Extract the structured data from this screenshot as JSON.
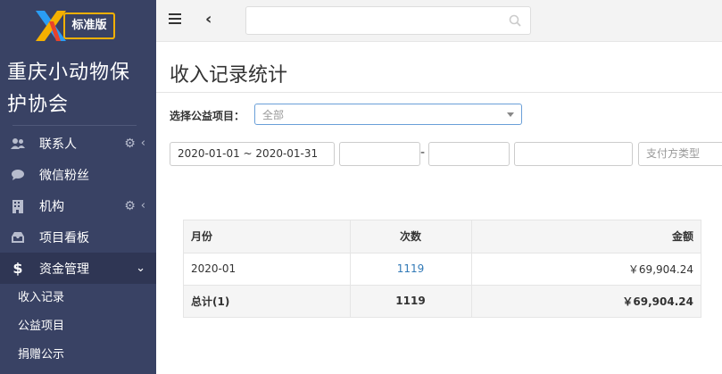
{
  "brand": {
    "badge": "标准版",
    "org_name": "重庆小动物保护协会"
  },
  "sidebar": {
    "items": [
      {
        "label": "联系人",
        "icon": "users-icon",
        "has_gear": true,
        "has_caret": true
      },
      {
        "label": "微信粉丝",
        "icon": "chat-icon",
        "has_gear": false,
        "has_caret": false
      },
      {
        "label": "机构",
        "icon": "building-icon",
        "has_gear": true,
        "has_caret": true
      },
      {
        "label": "项目看板",
        "icon": "inbox-icon",
        "has_gear": false,
        "has_caret": false
      },
      {
        "label": "资金管理",
        "icon": "dollar-icon",
        "has_gear": false,
        "has_caret": true,
        "active": true
      }
    ],
    "subitems": [
      {
        "label": "收入记录"
      },
      {
        "label": "公益项目"
      },
      {
        "label": "捐赠公示"
      }
    ]
  },
  "topbar": {
    "search_placeholder": ""
  },
  "main": {
    "title": "收入记录统计",
    "filter_label": "选择公益项目：",
    "project_select": "全部",
    "date_range": "2020-01-01 ~ 2020-01-31",
    "amount_min": "",
    "dash": "-",
    "amount_max": "",
    "field4": "",
    "payer_type_placeholder": "支付方类型"
  },
  "table": {
    "headers": [
      "月份",
      "次数",
      "金额"
    ],
    "rows": [
      {
        "month": "2020-01",
        "count": "1119",
        "amount": "￥69,904.24"
      }
    ],
    "total": {
      "label": "总计(1)",
      "count": "1119",
      "amount": "￥69,904.24"
    }
  },
  "colors": {
    "sidebar_bg": "#394264",
    "badge_border": "#f4b000",
    "link": "#337ab7"
  }
}
